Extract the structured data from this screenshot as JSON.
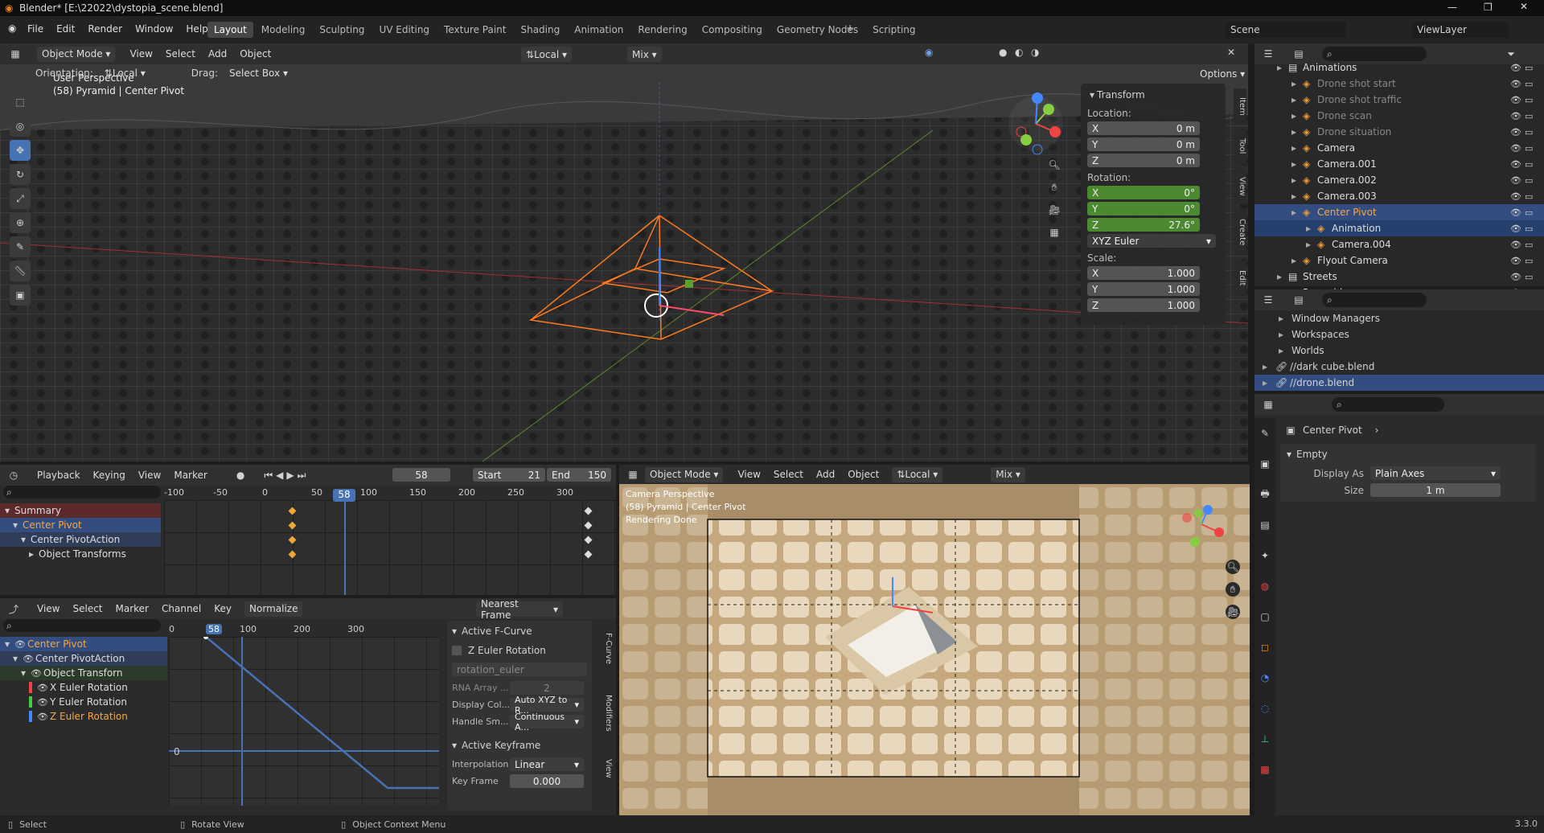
{
  "window": {
    "title": "Blender* [E:\\22022\\dystopia_scene.blend]"
  },
  "menu": [
    "File",
    "Edit",
    "Render",
    "Window",
    "Help"
  ],
  "workspaces": [
    "Layout",
    "Modeling",
    "Sculpting",
    "UV Editing",
    "Texture Paint",
    "Shading",
    "Animation",
    "Rendering",
    "Compositing",
    "Geometry Nodes",
    "Scripting"
  ],
  "top_right": {
    "scene": "Scene",
    "view_layer": "ViewLayer"
  },
  "viewport": {
    "mode": "Object Mode",
    "menus": [
      "View",
      "Select",
      "Add",
      "Object"
    ],
    "orientation_label": "Orientation:",
    "orientation": "Local",
    "drag_label": "Drag:",
    "drag": "Select Box",
    "transform_pivot": "Local",
    "snap_mix": "Mix",
    "options": "Options",
    "info1": "User Perspective",
    "info2": "(58) Pyramid | Center Pivot"
  },
  "npanel": {
    "title": "Transform",
    "location": "Location:",
    "rotation": "Rotation:",
    "scale": "Scale:",
    "loc": [
      {
        "a": "X",
        "v": "0 m"
      },
      {
        "a": "Y",
        "v": "0 m"
      },
      {
        "a": "Z",
        "v": "0 m"
      }
    ],
    "rot": [
      {
        "a": "X",
        "v": "0°"
      },
      {
        "a": "Y",
        "v": "0°"
      },
      {
        "a": "Z",
        "v": "27.6°"
      }
    ],
    "rot_mode": "XYZ Euler",
    "scl": [
      {
        "a": "X",
        "v": "1.000"
      },
      {
        "a": "Y",
        "v": "1.000"
      },
      {
        "a": "Z",
        "v": "1.000"
      }
    ],
    "tabs": [
      "Item",
      "Tool",
      "View",
      "Create",
      "Edit"
    ]
  },
  "outliner": [
    {
      "t": "Animations",
      "d": 1
    },
    {
      "t": "Drone shot start",
      "d": 2,
      "dim": true
    },
    {
      "t": "Drone shot traffic",
      "d": 2,
      "dim": true
    },
    {
      "t": "Drone scan",
      "d": 2,
      "dim": true
    },
    {
      "t": "Drone situation",
      "d": 2,
      "dim": true
    },
    {
      "t": "Camera",
      "d": 2
    },
    {
      "t": "Camera.001",
      "d": 2
    },
    {
      "t": "Camera.002",
      "d": 2
    },
    {
      "t": "Camera.003",
      "d": 2
    },
    {
      "t": "Center Pivot",
      "d": 2,
      "sel": true
    },
    {
      "t": "Animation",
      "d": 3,
      "sel2": true
    },
    {
      "t": "Camera.004",
      "d": 3
    },
    {
      "t": "Flyout Camera",
      "d": 2
    },
    {
      "t": "Streets",
      "d": 1
    },
    {
      "t": "Pyramid",
      "d": 1
    }
  ],
  "outliner2": [
    {
      "t": "Window Managers"
    },
    {
      "t": "Workspaces"
    },
    {
      "t": "Worlds"
    },
    {
      "t": "//dark cube.blend"
    },
    {
      "t": "//drone.blend",
      "sel": true
    }
  ],
  "properties": {
    "object": "Center Pivot",
    "panel": "Empty",
    "display_as_label": "Display As",
    "display_as": "Plain Axes",
    "size_label": "Size",
    "size": "1 m"
  },
  "timeline": {
    "menus": [
      "Playback",
      "Keying",
      "View",
      "Marker"
    ],
    "frame": "58",
    "start_label": "Start",
    "start": "21",
    "end_label": "End",
    "end": "150",
    "ruler": [
      "-100",
      "-50",
      "0",
      "50",
      "100",
      "150",
      "200",
      "250",
      "300"
    ],
    "tracks": [
      "Summary",
      "Center Pivot",
      "Center PivotAction",
      "Object Transforms"
    ]
  },
  "graph": {
    "menus": [
      "View",
      "Select",
      "Marker",
      "Channel",
      "Key"
    ],
    "normalize": "Normalize",
    "snap": "Nearest Frame",
    "ruler": [
      "0",
      "58",
      "100",
      "200",
      "300"
    ],
    "zero": "0",
    "channels": [
      "Center Pivot",
      "Center PivotAction",
      "Object Transforn",
      "X Euler Rotation",
      "Y Euler Rotation",
      "Z Euler Rotation"
    ],
    "fcurve_title": "Active F-Curve",
    "fcurve": "Z Euler Rotation",
    "path": "rotation_euler",
    "rna_label": "RNA Array ...",
    "rna": "2",
    "disp_label": "Display Col...",
    "disp": "Auto XYZ to R...",
    "handle_label": "Handle Sm...",
    "handle": "Continuous A...",
    "key_title": "Active Keyframe",
    "interp_label": "Interpolation",
    "interp": "Linear",
    "kf_label": "Key Frame",
    "kf": "0.000",
    "tabs": [
      "F-Curve",
      "Modifiers",
      "View"
    ]
  },
  "camview": {
    "info1": "Camera Perspective",
    "info2": "(58) Pyramid | Center Pivot",
    "info3": "Rendering Done",
    "mode": "Object Mode",
    "menus": [
      "View",
      "Select",
      "Add",
      "Object"
    ],
    "orient": "Local",
    "mix": "Mix"
  },
  "status": {
    "select": "Select",
    "rotate": "Rotate View",
    "context": "Object Context Menu",
    "version": "3.3.0"
  },
  "colors": {
    "accent": "#4772b3",
    "selected": "#334d80",
    "orange": "#ff7a1e",
    "green_field": "#4c8a31"
  }
}
